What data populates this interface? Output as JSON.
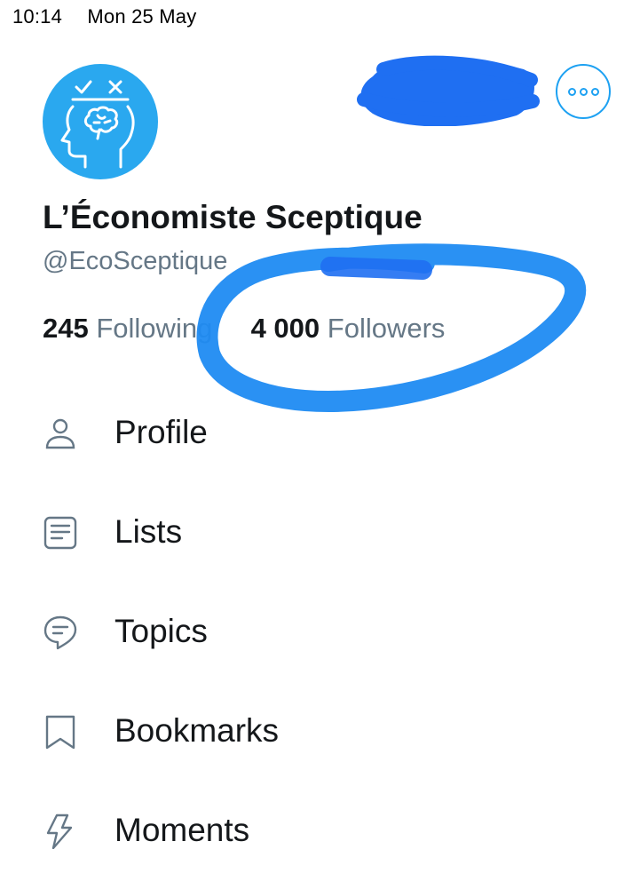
{
  "status_bar": {
    "time": "10:14",
    "date": "Mon 25 May"
  },
  "profile": {
    "display_name": "L’Économiste Sceptique",
    "handle": "@EcoSceptique",
    "avatar_icon": "head-brain-check-x-icon",
    "more_icon": "more-options-icon"
  },
  "stats": {
    "following_count": "245",
    "following_label": "Following",
    "followers_count": "4 000",
    "followers_label": "Followers"
  },
  "menu": {
    "items": [
      {
        "label": "Profile",
        "icon": "person-icon"
      },
      {
        "label": "Lists",
        "icon": "list-icon"
      },
      {
        "label": "Topics",
        "icon": "topic-bubble-icon"
      },
      {
        "label": "Bookmarks",
        "icon": "bookmark-icon"
      },
      {
        "label": "Moments",
        "icon": "lightning-icon"
      }
    ]
  },
  "colors": {
    "accent": "#1da1f2",
    "avatar_bg": "#2aa8ef",
    "annotation": "#1f8bf2",
    "text_primary": "#14171a",
    "text_secondary": "#657786"
  }
}
